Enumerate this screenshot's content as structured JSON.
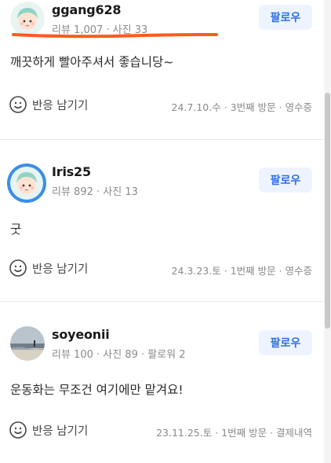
{
  "reviews": [
    {
      "username": "ggang628",
      "meta": "리뷰 1,007 · 사진 33",
      "follow_label": "팔로우",
      "text": "깨끗하게 빨아주셔서 좋습니당~",
      "react_label": "반응 남기기",
      "visit": "24.7.10.수 · 3번째 방문 · 영수증",
      "avatar_icon": "mint-hair-character-avatar"
    },
    {
      "username": "Iris25",
      "meta": "리뷰 892 · 사진 13",
      "follow_label": "팔로우",
      "text": "굿",
      "react_label": "반응 남기기",
      "visit": "24.3.23.토 · 1번째 방문 · 영수증",
      "avatar_icon": "mint-hair-character-avatar-blue-frame"
    },
    {
      "username": "soyeonii",
      "meta": "리뷰 100 · 사진 89 · 팔로워 2",
      "follow_label": "팔로우",
      "text": "운동화는 무조건 여기에만 맡겨요!",
      "react_label": "반응 남기기",
      "visit": "23.11.25.토 · 1번째 방문 · 결제내역",
      "avatar_icon": "beach-photo-avatar"
    }
  ],
  "colors": {
    "follow_text": "#2f6fe4",
    "follow_bg": "#eef4ff",
    "annotation": "#ff5a1f",
    "meta_text": "#8a8a8a"
  }
}
